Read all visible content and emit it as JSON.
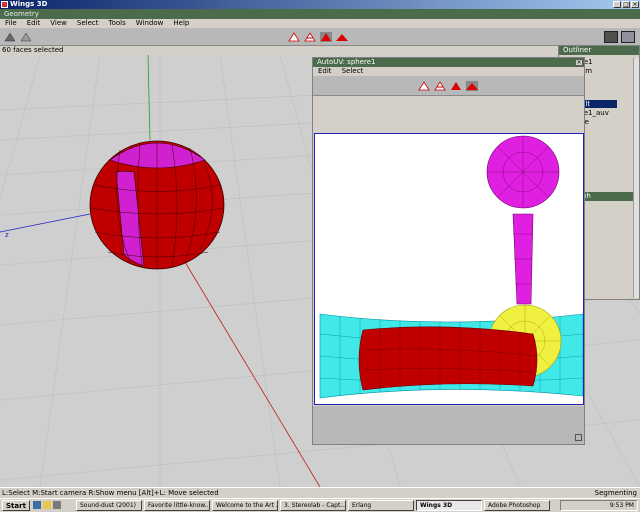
{
  "window": {
    "title": "Wings 3D",
    "minimize": "_",
    "maximize": "□",
    "close": "×"
  },
  "geometry_bar": {
    "label": "Geometry"
  },
  "menu": {
    "items": [
      "File",
      "Edit",
      "View",
      "Select",
      "Tools",
      "Window",
      "Help"
    ]
  },
  "info": {
    "text": "60 faces selected"
  },
  "viewport": {
    "axis_label": "z"
  },
  "outliner": {
    "title": "Outliner",
    "items": [
      "re1",
      "om",
      "ult",
      "re1_auv",
      "se"
    ],
    "graph_title": "y Graph",
    "graph_item": "1"
  },
  "autouv": {
    "title": "AutoUV: sphere1",
    "menu": [
      "Edit",
      "Select"
    ]
  },
  "statusbar": {
    "hint": "L:Select   M:Start camera   R:Show menu   [Alt]+L: Move selected",
    "mode": "Segmenting"
  },
  "taskbar": {
    "start": "Start",
    "tasks": [
      "Sound-dust (2001)",
      "Favorite little-know...",
      "Welcome to the Art ...",
      "3. Stereolab - Capt...",
      "Erlang",
      "Wings 3D",
      "Adobe Photoshop"
    ],
    "clock": "9:53 PM"
  },
  "colors": {
    "accent": "#4b6b4b",
    "face_red": "#c00000",
    "face_magenta": "#e020e0",
    "uv_cyan": "#40e8e8",
    "uv_yellow": "#f0f040"
  }
}
